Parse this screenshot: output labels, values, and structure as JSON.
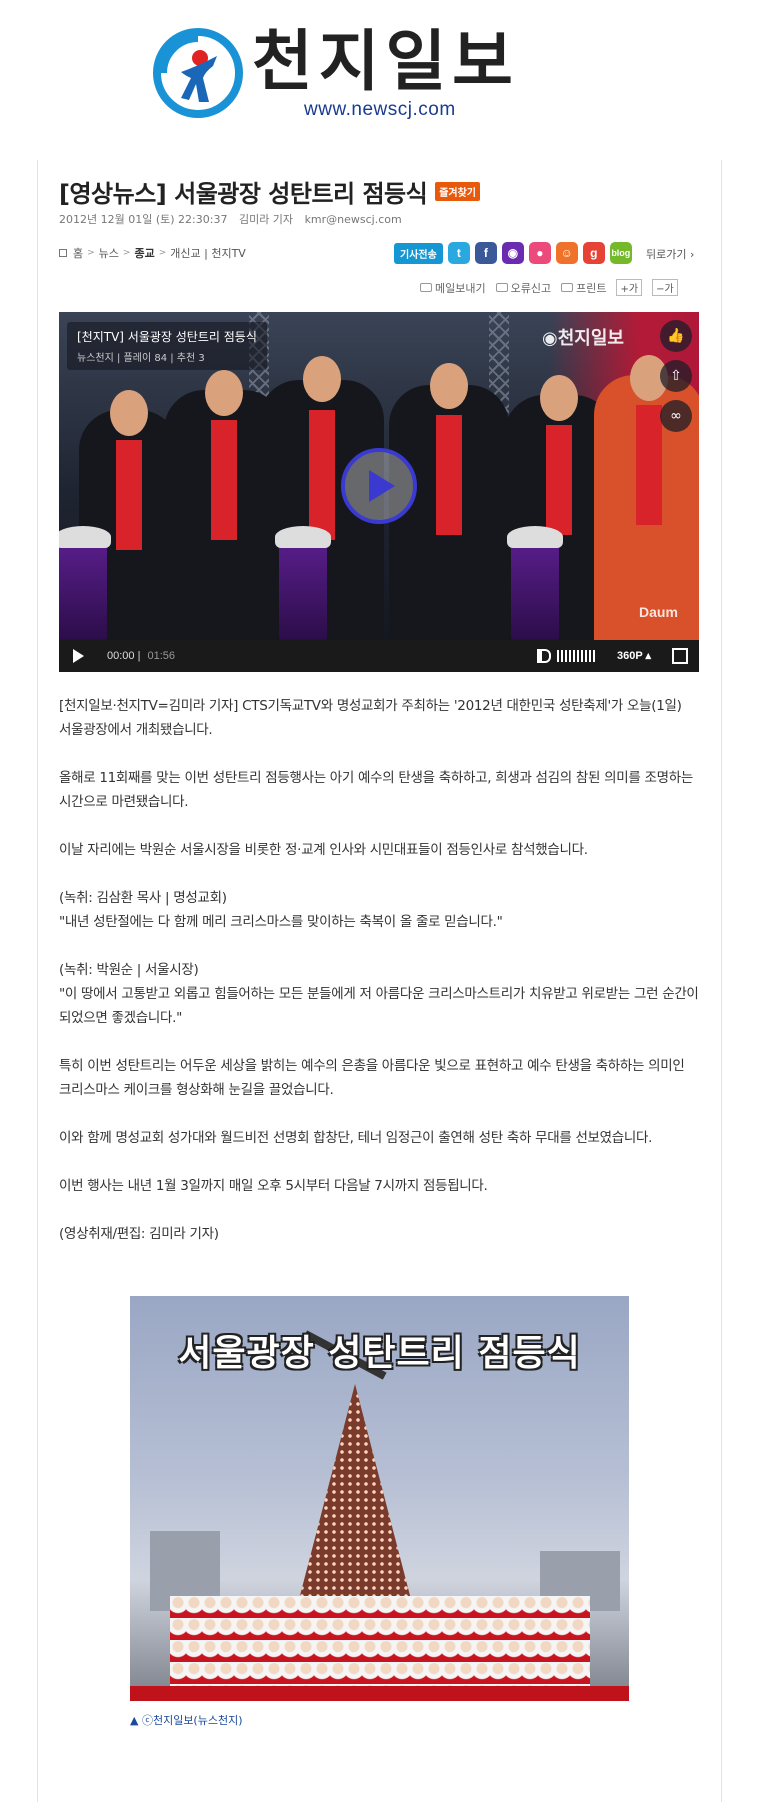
{
  "masthead": {
    "logo_name": "천지일보",
    "logo_url": "www.newscj.com"
  },
  "article": {
    "title": "[영상뉴스] 서울광장 성탄트리 점등식",
    "fav_badge": "즐겨찾기",
    "date": "2012년 12월 01일 (토) 22:30:37",
    "author": "김미라 기자",
    "email": "kmr@newscj.com"
  },
  "breadcrumb": [
    "홈",
    "뉴스",
    "종교",
    "개신교 | 천지TV"
  ],
  "share": {
    "send_label": "기사전송",
    "sns_icons": [
      "twitter-icon",
      "facebook-icon",
      "yozm-icon",
      "me2day-icon",
      "cyworld-icon",
      "google-icon",
      "blog-icon"
    ],
    "back_label": "뒤로가기"
  },
  "tools": {
    "email_label": "메일보내기",
    "report_label": "오류신고",
    "print_label": "프린트",
    "font_up": "가",
    "font_down": "가"
  },
  "player": {
    "video_title": "[천지TV] 서울광장 성탄트리 점등식",
    "channel": "뉴스천지",
    "plays": "플레이 84",
    "likes": "추천 3",
    "brand": "천지일보",
    "watermark": "Daum",
    "current_time": "00:00",
    "duration": "01:56",
    "quality": "360P"
  },
  "body_paragraphs": [
    "[천지일보·천지TV=김미라 기자] CTS기독교TV와 명성교회가 주최하는 '2012년 대한민국 성탄축제'가 오늘(1일) 서울광장에서 개최됐습니다.",
    "올해로 11회째를 맞는 이번 성탄트리 점등행사는 아기 예수의 탄생을 축하하고, 희생과 섬김의 참된 의미를 조명하는 시간으로 마련됐습니다.",
    "이날 자리에는 박원순 서울시장을 비롯한 정·교계 인사와 시민대표들이 점등인사로 참석했습니다.",
    "(녹취: 김삼환 목사 | 명성교회)\n\"내년 성탄절에는 다 함께 메리 크리스마스를 맞이하는 축복이 올 줄로 믿습니다.\"",
    "(녹취: 박원순 | 서울시장)\n\"이 땅에서 고통받고 외롭고 힘들어하는 모든 분들에게 저 아름다운 크리스마스트리가 치유받고 위로받는 그런 순간이 되었으면 좋겠습니다.\"",
    "특히 이번 성탄트리는 어두운 세상을 밝히는 예수의 은총을 아름다운 빛으로 표현하고 예수 탄생을 축하하는 의미인 크리스마스 케이크를 형상화해 눈길을 끌었습니다.",
    "이와 함께 명성교회 성가대와 월드비전 선명회 합창단, 테너 임정근이 출연해 성탄 축하 무대를 선보였습니다.",
    "이번 행사는 내년 1월 3일까지 매일 오후 5시부터 다음날 7시까지 점등됩니다.",
    "(영상취재/편집: 김미라 기자)"
  ],
  "photo": {
    "overlay_title": "서울광장 성탄트리 점등식",
    "caption": "▲ ⓒ천지일보(뉴스천지)"
  },
  "colors": {
    "badge": "#e8590c",
    "send": "#1597d4",
    "link": "#1a4a9a",
    "play_ring": "#3a3ad0"
  }
}
